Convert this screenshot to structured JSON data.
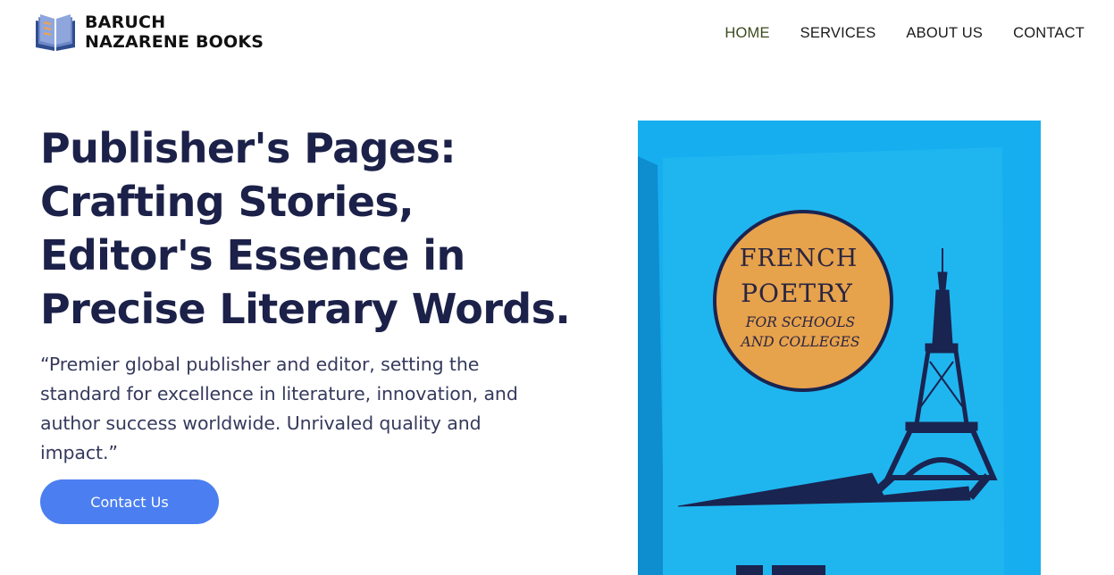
{
  "header": {
    "logo_line1": "BARUCH",
    "logo_line2": "NAZARENE BOOKS",
    "logo_icon": "open-book-icon",
    "nav": [
      {
        "label": "HOME",
        "active": true
      },
      {
        "label": "SERVICES",
        "active": false
      },
      {
        "label": "ABOUT US",
        "active": false
      },
      {
        "label": "CONTACT",
        "active": false
      }
    ]
  },
  "hero": {
    "title_lines": [
      "Publisher's Pages:",
      "Crafting Stories,",
      "Editor's Essence in",
      "Precise Literary Words."
    ],
    "quote_lines": [
      "“Premier global publisher and editor, setting the",
      "standard for excellence in literature, innovation, and",
      "author success worldwide. Unrivaled quality and",
      "impact.”"
    ],
    "cta_label": "Contact Us"
  },
  "book_cover": {
    "line1": "FRENCH",
    "line2": "POETRY",
    "line3": "FOR SCHOOLS",
    "line4": "AND COLLEGES"
  },
  "colors": {
    "title": "#1c2149",
    "cta": "#4b7ef0",
    "nav_active": "#3b4a1c",
    "cover_blue": "#1ab0ec",
    "badge_orange": "#e7a24c"
  }
}
